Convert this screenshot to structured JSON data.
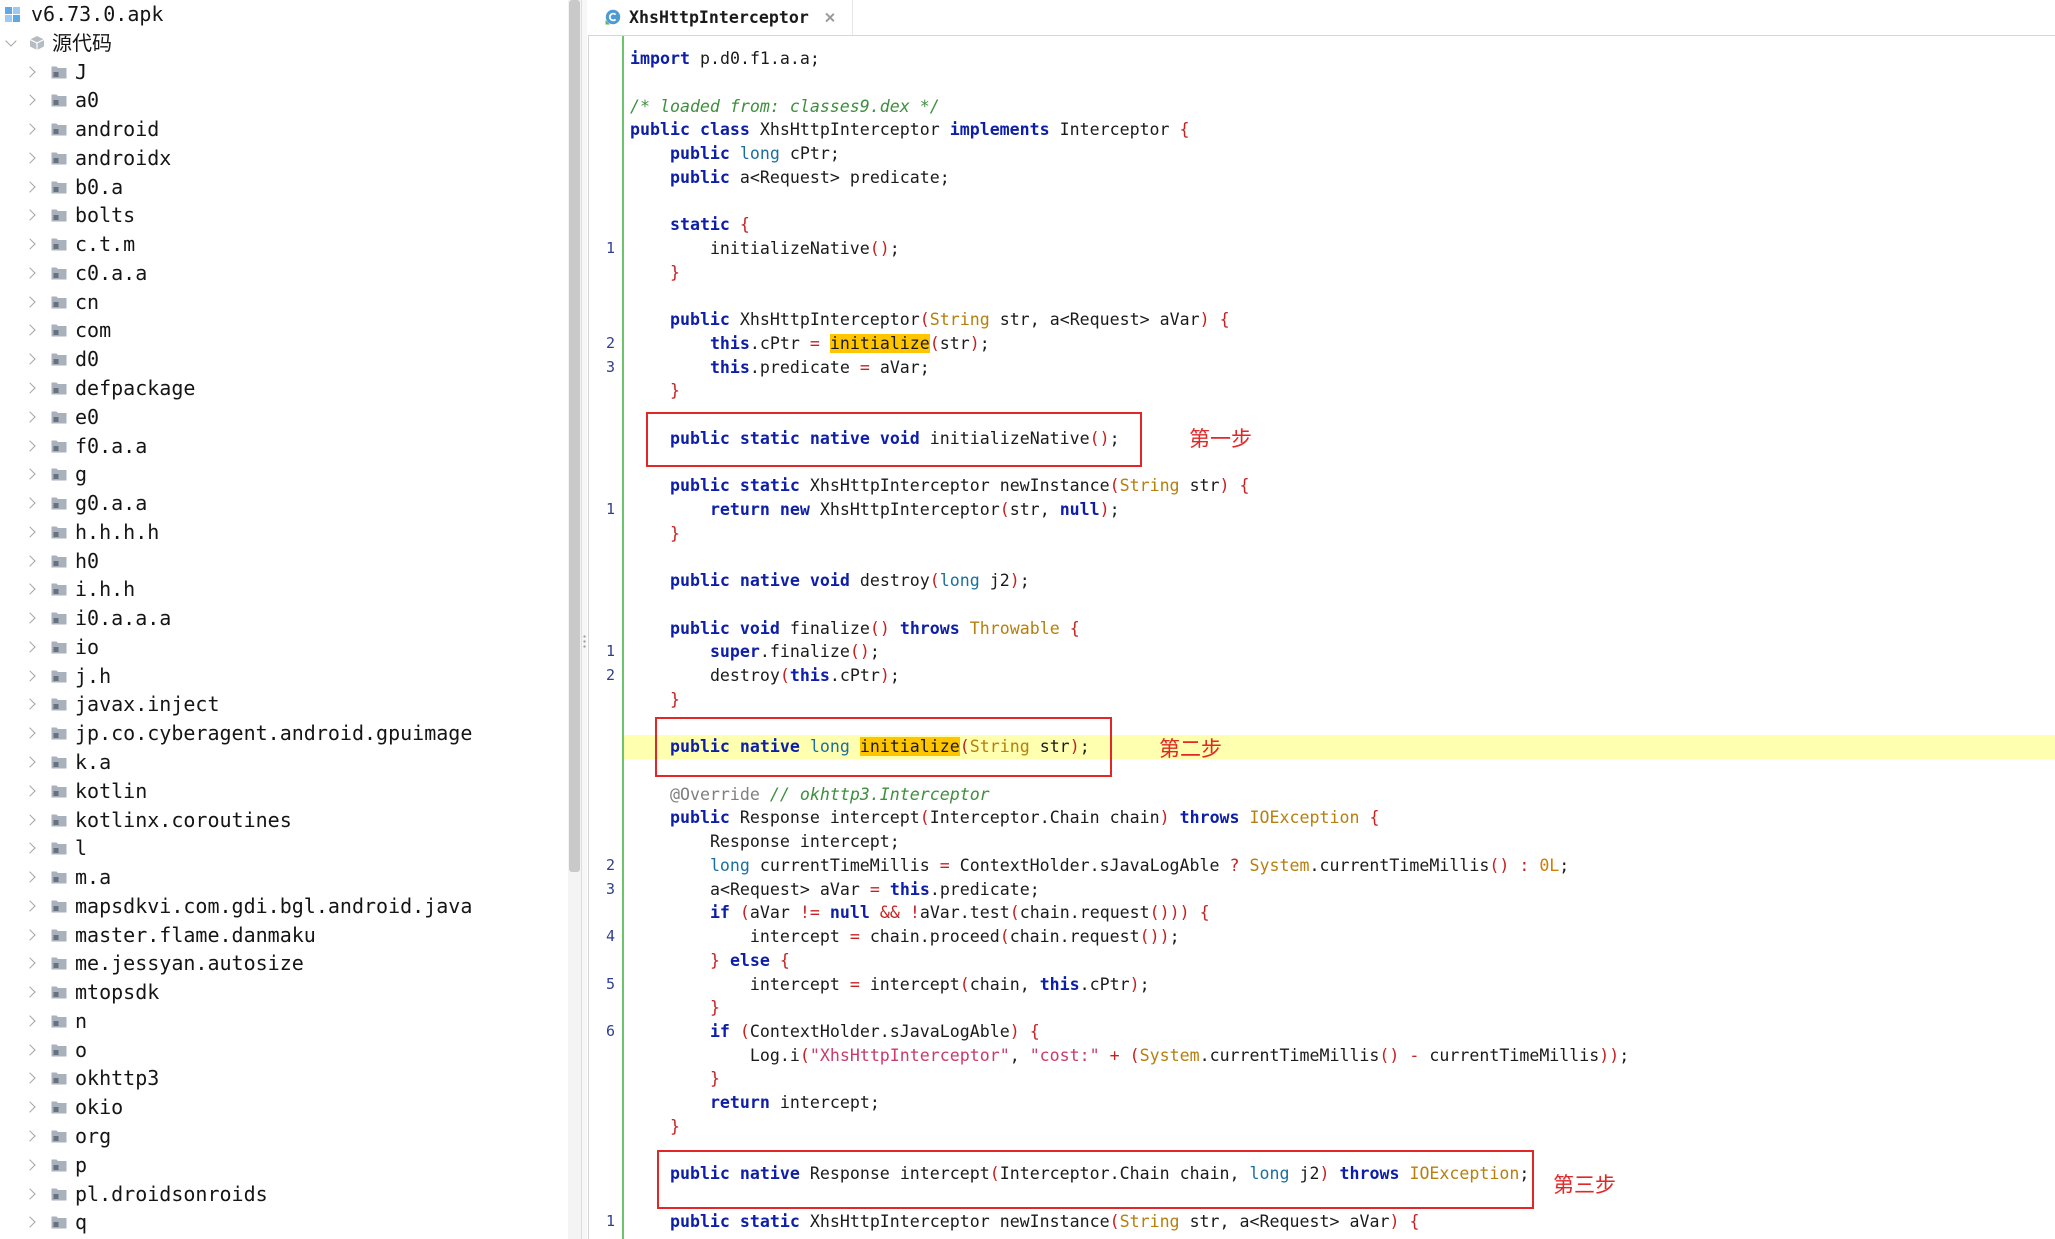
{
  "theme": {
    "text": "#1b1b1b",
    "keyword": "#0d1fa8",
    "primitive": "#1a6fa0",
    "lang_class": "#b77f0d",
    "punct": "#c62020",
    "string": "#c93a6e",
    "number": "#d27c00",
    "comment": "#3e8f3e",
    "annotation": "#7f7f7f",
    "line_number": "#2f3e8f",
    "search_highlight": "#ffc600",
    "current_line": "#ffffb0",
    "change_bar": "#6cc46c",
    "annotation_red": "#e32626"
  },
  "tree": {
    "root": {
      "label": "v6.73.0.apk",
      "icon": "apk-icon"
    },
    "source": {
      "label": "源代码",
      "icon": "package-icon",
      "expanded": true
    },
    "package_icon": "folder-icon",
    "packages": [
      "J",
      "a0",
      "android",
      "androidx",
      "b0.a",
      "bolts",
      "c.t.m",
      "c0.a.a",
      "cn",
      "com",
      "d0",
      "defpackage",
      "e0",
      "f0.a.a",
      "g",
      "g0.a.a",
      "h.h.h.h",
      "h0",
      "i.h.h",
      "i0.a.a.a",
      "io",
      "j.h",
      "javax.inject",
      "jp.co.cyberagent.android.gpuimage",
      "k.a",
      "kotlin",
      "kotlinx.coroutines",
      "l",
      "m.a",
      "mapsdkvi.com.gdi.bgl.android.java",
      "master.flame.danmaku",
      "me.jessyan.autosize",
      "mtopsdk",
      "n",
      "o",
      "okhttp3",
      "okio",
      "org",
      "p",
      "pl.droidsonroids",
      "q"
    ]
  },
  "editor": {
    "tab": {
      "title": "XhsHttpInterceptor",
      "icon": "class-file-icon",
      "close_icon": "close-icon"
    },
    "lines": [
      {
        "text": "import p.d0.f1.a.a;"
      },
      {
        "text": ""
      },
      {
        "text": "/* loaded from: classes9.dex */"
      },
      {
        "text": "public class XhsHttpInterceptor implements Interceptor {"
      },
      {
        "text": "    public long cPtr;"
      },
      {
        "text": "    public a<Request> predicate;"
      },
      {
        "text": ""
      },
      {
        "text": "    static {"
      },
      {
        "n": "1",
        "text": "        initializeNative();"
      },
      {
        "text": "    }"
      },
      {
        "text": ""
      },
      {
        "text": "    public XhsHttpInterceptor(String str, a<Request> aVar) {"
      },
      {
        "n": "2",
        "text": "        this.cPtr = initialize(str);"
      },
      {
        "n": "3",
        "text": "        this.predicate = aVar;"
      },
      {
        "text": "    }"
      },
      {
        "text": ""
      },
      {
        "text": "    public static native void initializeNative();"
      },
      {
        "text": ""
      },
      {
        "text": "    public static XhsHttpInterceptor newInstance(String str) {"
      },
      {
        "n": "1",
        "text": "        return new XhsHttpInterceptor(str, null);"
      },
      {
        "text": "    }"
      },
      {
        "text": ""
      },
      {
        "text": "    public native void destroy(long j2);"
      },
      {
        "text": ""
      },
      {
        "text": "    public void finalize() throws Throwable {"
      },
      {
        "n": "1",
        "text": "        super.finalize();"
      },
      {
        "n": "2",
        "text": "        destroy(this.cPtr);"
      },
      {
        "text": "    }"
      },
      {
        "text": ""
      },
      {
        "current": true,
        "text": "    public native long initialize(String str);"
      },
      {
        "text": ""
      },
      {
        "text": "    @Override // okhttp3.Interceptor"
      },
      {
        "text": "    public Response intercept(Interceptor.Chain chain) throws IOException {"
      },
      {
        "text": "        Response intercept;"
      },
      {
        "n": "2",
        "text": "        long currentTimeMillis = ContextHolder.sJavaLogAble ? System.currentTimeMillis() : 0L;"
      },
      {
        "n": "3",
        "text": "        a<Request> aVar = this.predicate;"
      },
      {
        "text": "        if (aVar != null && !aVar.test(chain.request())) {"
      },
      {
        "n": "4",
        "text": "            intercept = chain.proceed(chain.request());"
      },
      {
        "text": "        } else {"
      },
      {
        "n": "5",
        "text": "            intercept = intercept(chain, this.cPtr);"
      },
      {
        "text": "        }"
      },
      {
        "n": "6",
        "text": "        if (ContextHolder.sJavaLogAble) {"
      },
      {
        "text": "            Log.i(\"XhsHttpInterceptor\", \"cost:\" + (System.currentTimeMillis() - currentTimeMillis));"
      },
      {
        "text": "        }"
      },
      {
        "text": "        return intercept;"
      },
      {
        "text": "    }"
      },
      {
        "text": ""
      },
      {
        "text": "    public native Response intercept(Interceptor.Chain chain, long j2) throws IOException;"
      },
      {
        "text": ""
      },
      {
        "n": "1",
        "text": "    public static XhsHttpInterceptor newInstance(String str, a<Request> aVar) {"
      }
    ]
  },
  "annotations": [
    {
      "label": "第一步"
    },
    {
      "label": "第二步"
    },
    {
      "label": "第三步"
    }
  ]
}
